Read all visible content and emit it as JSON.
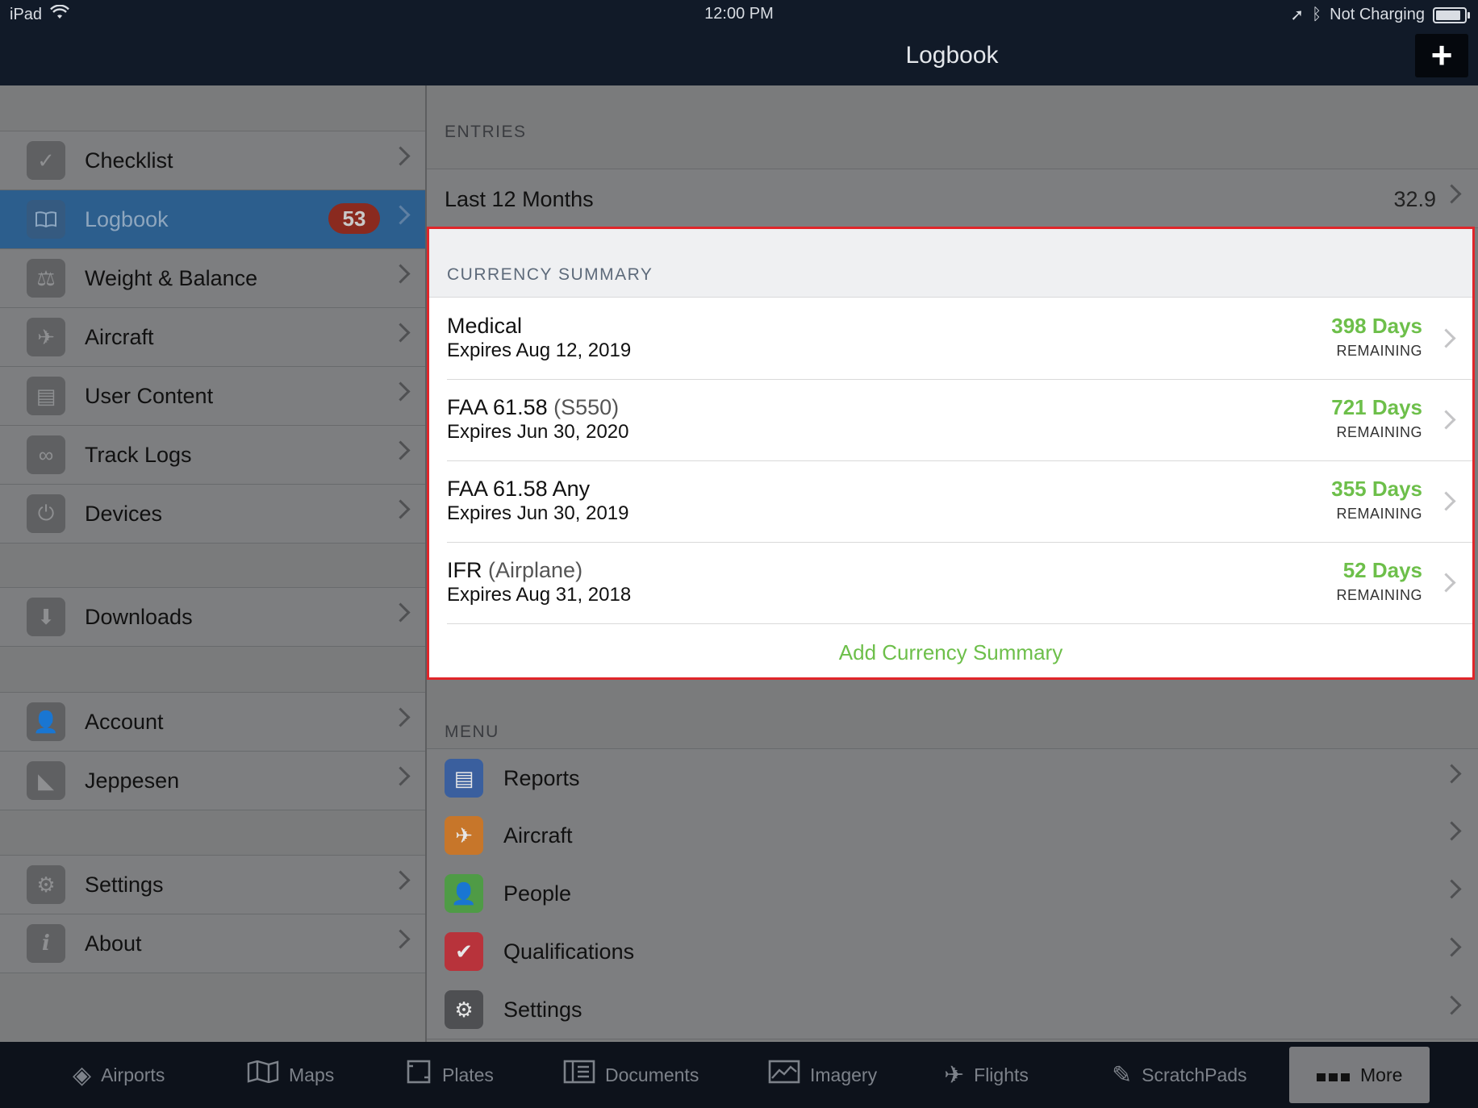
{
  "status_bar": {
    "device": "iPad",
    "wifi_icon": "wifi-icon",
    "time": "12:00 PM",
    "charging": "Not Charging"
  },
  "nav": {
    "title": "Logbook",
    "add_icon": "plus-icon",
    "add_symbol": "+"
  },
  "sidebar": {
    "items": [
      {
        "label": "Checklist",
        "icon": "checkmark-icon",
        "glyph": "✓"
      },
      {
        "label": "Logbook",
        "icon": "book-icon",
        "glyph": "📖",
        "badge": "53"
      },
      {
        "label": "Weight & Balance",
        "icon": "weight-icon",
        "glyph": "⚖"
      },
      {
        "label": "Aircraft",
        "icon": "airplane-icon",
        "glyph": "✈"
      },
      {
        "label": "User Content",
        "icon": "document-icon",
        "glyph": "▤"
      },
      {
        "label": "Track Logs",
        "icon": "tracklog-icon",
        "glyph": "∞"
      },
      {
        "label": "Devices",
        "icon": "plug-icon",
        "glyph": "⏻"
      },
      {
        "label": "Downloads",
        "icon": "download-icon",
        "glyph": "⬇"
      },
      {
        "label": "Account",
        "icon": "person-icon",
        "glyph": "👤"
      },
      {
        "label": "Jeppesen",
        "icon": "jeppesen-icon",
        "glyph": "◣"
      },
      {
        "label": "Settings",
        "icon": "gear-icon",
        "glyph": "⚙"
      },
      {
        "label": "About",
        "icon": "info-icon",
        "glyph": "i"
      }
    ]
  },
  "entries": {
    "header": "ENTRIES",
    "row_label": "Last 12 Months",
    "row_value": "32.9"
  },
  "currency": {
    "header": "CURRENCY SUMMARY",
    "rows": [
      {
        "title": "Medical",
        "sub": "",
        "expires": "Expires Aug 12, 2019",
        "days": "398 Days",
        "remaining": "REMAINING"
      },
      {
        "title": "FAA 61.58",
        "sub": "(S550)",
        "expires": "Expires Jun 30, 2020",
        "days": "721 Days",
        "remaining": "REMAINING"
      },
      {
        "title": "FAA 61.58 Any",
        "sub": "",
        "expires": "Expires Jun 30, 2019",
        "days": "355 Days",
        "remaining": "REMAINING"
      },
      {
        "title": "IFR",
        "sub": "(Airplane)",
        "expires": "Expires Aug 31, 2018",
        "days": "52 Days",
        "remaining": "REMAINING"
      }
    ],
    "add_label": "Add Currency Summary",
    "highlight_color": "#e0262a",
    "days_color": "#6dbf4a"
  },
  "menu": {
    "header": "MENU",
    "items": [
      {
        "label": "Reports",
        "icon": "reports-icon",
        "glyph": "▤",
        "color": "#3a5f9e"
      },
      {
        "label": "Aircraft",
        "icon": "airplane-icon",
        "glyph": "✈",
        "color": "#c7762a"
      },
      {
        "label": "People",
        "icon": "add-person-icon",
        "glyph": "👤",
        "color": "#4f9b46"
      },
      {
        "label": "Qualifications",
        "icon": "badge-check-icon",
        "glyph": "✔",
        "color": "#b8333b"
      },
      {
        "label": "Settings",
        "icon": "gears-icon",
        "glyph": "⚙",
        "color": "#4e4f52"
      }
    ]
  },
  "tabbar": {
    "tabs": [
      {
        "label": "Airports",
        "icon": "compass-icon",
        "glyph": "◈"
      },
      {
        "label": "Maps",
        "icon": "map-icon",
        "glyph": "🗺"
      },
      {
        "label": "Plates",
        "icon": "plates-icon",
        "glyph": "▯"
      },
      {
        "label": "Documents",
        "icon": "documents-icon",
        "glyph": "▥"
      },
      {
        "label": "Imagery",
        "icon": "imagery-icon",
        "glyph": "▦"
      },
      {
        "label": "Flights",
        "icon": "departure-icon",
        "glyph": "✈"
      },
      {
        "label": "ScratchPads",
        "icon": "pencil-icon",
        "glyph": "✎"
      },
      {
        "label": "More",
        "icon": "more-icon",
        "glyph": "■■■"
      }
    ]
  }
}
